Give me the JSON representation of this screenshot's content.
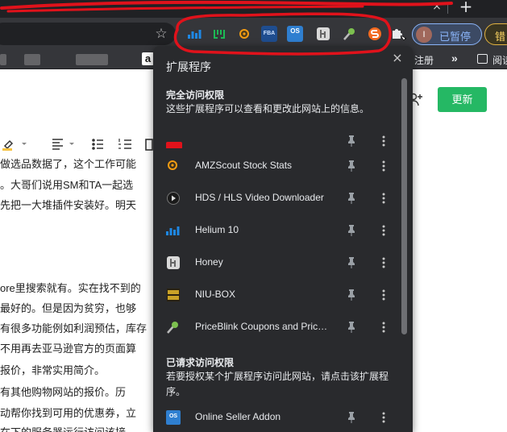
{
  "browser": {
    "tab_close": "×",
    "new_tab": "+",
    "star": "☆",
    "profile": {
      "avatar_letter": "I",
      "label": "已暂停"
    },
    "error_label": "错",
    "toolbar_extensions": [
      {
        "icon": "helium10-icon",
        "color": "#1e88e5"
      },
      {
        "icon": "junglescout-icon",
        "color": "#1db954"
      },
      {
        "icon": "amzscout-icon",
        "color": "#f39c12"
      },
      {
        "icon": "fba-icon",
        "color": "#2b6cb0",
        "text": "FBA"
      },
      {
        "icon": "online-seller-addon-icon",
        "color": "#3a8ed8",
        "text": "OS"
      },
      {
        "icon": "honey-icon",
        "color": "#e0e0e0"
      },
      {
        "icon": "pricebllink-icon",
        "color": "#7cc04f"
      },
      {
        "icon": "sellersprite-icon",
        "color": "#f26b21"
      }
    ]
  },
  "bookmarks": {
    "register": "注册",
    "chevrons": "»",
    "reading": "阅读"
  },
  "page": {
    "update_button": "更新",
    "lines": [
      "做选品数据了，这个工作可能",
      "。大哥们说用SM和TA一起选",
      "先把一大堆插件安装好。明天",
      "ore里搜索就有。实在找不到的",
      "最好的。但是因为贫穷，也够",
      "有很多功能例如利润预估，库存",
      "不用再去亚马逊官方的页面算",
      "报价，非常实用简介。",
      "有其他购物网站的报价。历",
      "动帮你找到可用的优惠券，立",
      "在下的服务器运行访问该接"
    ]
  },
  "popup": {
    "title": "扩展程序",
    "close": "×",
    "full_access": {
      "title": "完全访问权限",
      "desc": "这些扩展程序可以查看和更改此网站上的信息。"
    },
    "items": [
      {
        "name": "",
        "icon": "redacted-icon"
      },
      {
        "name": "AMZScout Stock Stats",
        "icon": "amzscout-icon"
      },
      {
        "name": "HDS / HLS Video Downloader",
        "icon": "play-icon"
      },
      {
        "name": "Helium 10",
        "icon": "helium10-icon"
      },
      {
        "name": "Honey",
        "icon": "honey-icon"
      },
      {
        "name": "NIU-BOX",
        "icon": "niubox-icon"
      },
      {
        "name": "PriceBlink Coupons and Price Comparison",
        "icon": "pricebllink-icon"
      }
    ],
    "requested_access": {
      "title": "已请求访问权限",
      "desc": "若要授权某个扩展程序访问此网站，请点击该扩展程序。"
    },
    "requested_items": [
      {
        "name": "Online Seller Addon",
        "icon": "online-seller-addon-icon"
      }
    ]
  }
}
